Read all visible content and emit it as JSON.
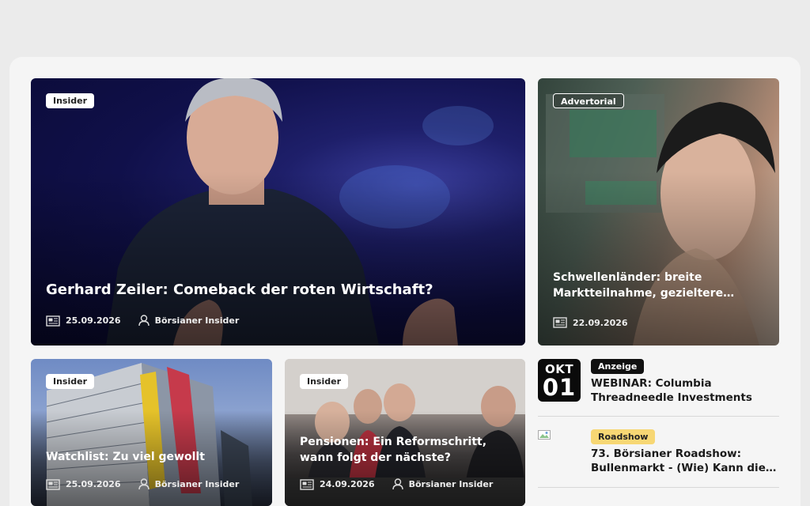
{
  "cards": [
    {
      "badge": "Insider",
      "title": "Gerhard Zeiler: Comeback der roten Wirtschaft?",
      "date": "25.09.2026",
      "author": "Börsianer Insider"
    },
    {
      "badge": "Advertorial",
      "title_line1": "Schwellenländer: breite",
      "title_line2": "Marktteilnahme, gezieltere…",
      "date": "22.09.2026"
    },
    {
      "badge": "Insider",
      "title": "Watchlist: Zu viel gewollt",
      "date": "25.09.2026",
      "author": "Börsianer Insider"
    },
    {
      "badge": "Insider",
      "title_line1": "Pensionen: Ein Reformschritt,",
      "title_line2": "wann folgt der nächste?",
      "date": "24.09.2026",
      "author": "Börsianer Insider"
    }
  ],
  "side": {
    "event": {
      "month": "OKT",
      "day": "01",
      "tag": "Anzeige",
      "title_line1": "WEBINAR: Columbia",
      "title_line2": "Threadneedle Investments"
    },
    "roadshow": {
      "tag": "Roadshow",
      "title_line1": "73. Börsianer Roadshow:",
      "title_line2": "Bullenmarkt - (Wie) Kann die…"
    }
  },
  "colors": {
    "tag_yellow": "#f7d774",
    "tag_black": "#111111"
  }
}
